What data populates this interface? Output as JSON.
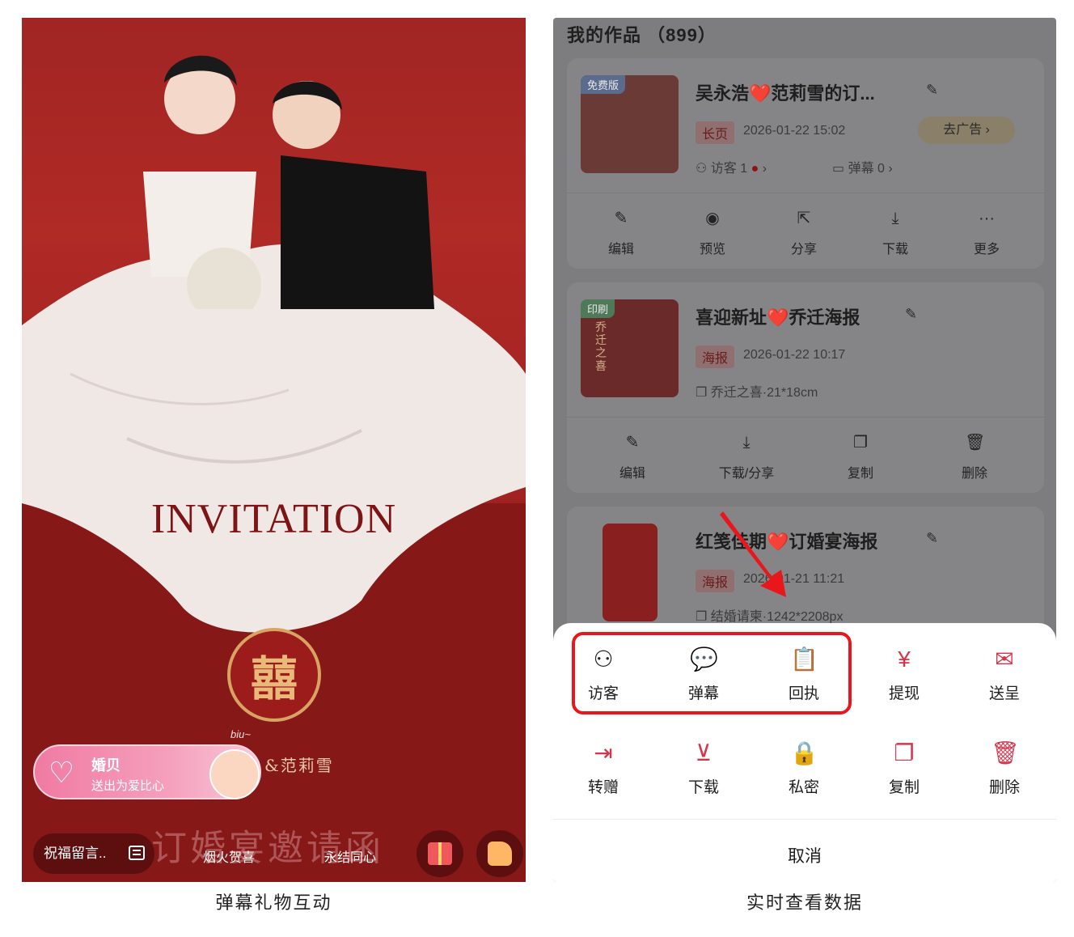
{
  "left_panel": {
    "invitation_text": "INVITATION",
    "xi_symbol": "囍",
    "names": "&范莉雪",
    "biu": "biu~",
    "gift_pill": {
      "title": "婚贝",
      "subtitle": "送出为爱比心"
    },
    "bottom_title": "订婚宴邀请函",
    "message_button": "祝福留言..",
    "gift_tags": [
      "烟火贺喜",
      "永结同心"
    ],
    "caption": "弹幕礼物互动"
  },
  "right_panel": {
    "page_title": "我的作品 （899）",
    "cards": [
      {
        "badge": "免费版",
        "title": "吴永浩❤️范莉雪的订...",
        "type": "长页",
        "date": "2026-01-22 15:02",
        "ad_button": "去广告",
        "visitors": "访客 1",
        "danmaku": "弹幕 0",
        "actions": [
          "编辑",
          "预览",
          "分享",
          "下载",
          "更多"
        ]
      },
      {
        "badge": "印刷",
        "title": "喜迎新址❤️乔迁海报",
        "type": "海报",
        "date": "2026-01-22 10:17",
        "meta": "乔迁之喜·21*18cm",
        "thumb_text": "乔迁之喜",
        "actions": [
          "编辑",
          "下载/分享",
          "复制",
          "删除"
        ]
      },
      {
        "title": "红笺佳期❤️订婚宴海报",
        "type": "海报",
        "date": "2026-01-21 11:21",
        "meta": "结婚请柬·1242*2208px"
      }
    ],
    "sheet": {
      "row1": [
        "访客",
        "弹幕",
        "回执",
        "提现",
        "送呈"
      ],
      "row2": [
        "转赠",
        "下载",
        "私密",
        "复制",
        "删除"
      ],
      "cancel": "取消"
    },
    "caption": "实时查看数据"
  },
  "colors": {
    "accent": "#d8334a",
    "highlight": "#e9161c",
    "wine": "#8e1c1d"
  }
}
